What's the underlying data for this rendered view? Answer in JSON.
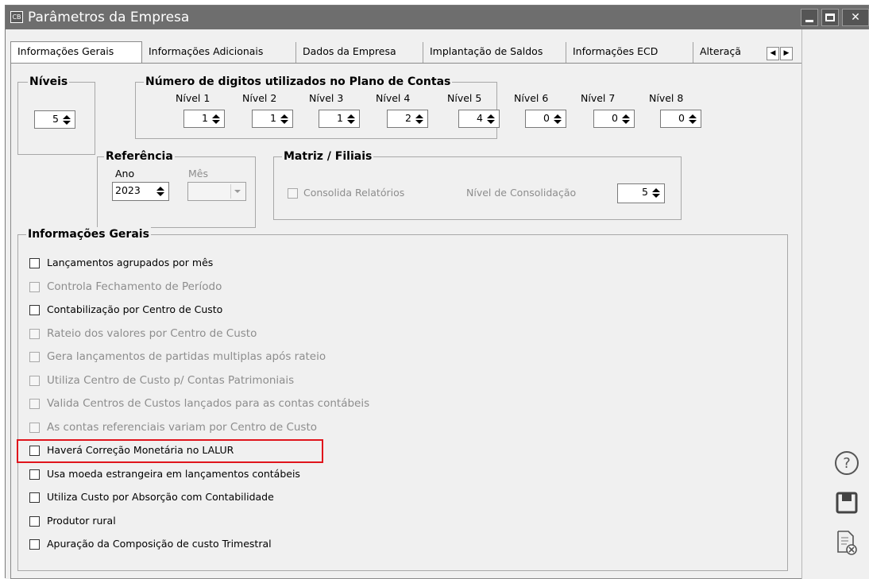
{
  "window": {
    "title": "Parâmetros da Empresa",
    "app_icon_text": "CB",
    "buttons": [
      "minimize",
      "maximize",
      "close"
    ]
  },
  "tabs": [
    {
      "label": "Informações Gerais",
      "active": true
    },
    {
      "label": "Informações Adicionais"
    },
    {
      "label": "Dados da Empresa"
    },
    {
      "label": "Implantação de Saldos"
    },
    {
      "label": "Informações ECD"
    },
    {
      "label": "Alteraçã"
    }
  ],
  "niveis": {
    "legend": "Níveis",
    "value": "5"
  },
  "digitos": {
    "legend": "Número de digitos utilizados no Plano de Contas",
    "levels": [
      {
        "label": "Nível 1",
        "value": "1"
      },
      {
        "label": "Nível 2",
        "value": "1"
      },
      {
        "label": "Nível 3",
        "value": "1"
      },
      {
        "label": "Nível 4",
        "value": "2"
      },
      {
        "label": "Nível 5",
        "value": "4"
      },
      {
        "label": "Nível 6",
        "value": "0"
      },
      {
        "label": "Nível 7",
        "value": "0"
      },
      {
        "label": "Nível 8",
        "value": "0"
      }
    ]
  },
  "referencia": {
    "legend": "Referência",
    "ano_label": "Ano",
    "ano_value": "2023",
    "mes_label": "Mês",
    "mes_value": ""
  },
  "matriz": {
    "legend": "Matriz / Filiais",
    "consolida_label": "Consolida Relatórios",
    "nivel_label": "Nível de Consolidação",
    "nivel_value": "5"
  },
  "gerais": {
    "legend": "Informações Gerais",
    "options": [
      {
        "label": "Lançamentos agrupados por mês",
        "checked": false,
        "enabled": true
      },
      {
        "label": "Controla Fechamento de Período",
        "checked": false,
        "enabled": false
      },
      {
        "label": "Contabilização por Centro de Custo",
        "checked": false,
        "enabled": true
      },
      {
        "label": "Rateio dos valores por Centro de Custo",
        "checked": false,
        "enabled": false
      },
      {
        "label": "Gera lançamentos de partidas multiplas após rateio",
        "checked": false,
        "enabled": false
      },
      {
        "label": "Utiliza Centro de  Custo p/ Contas Patrimoniais",
        "checked": false,
        "enabled": false
      },
      {
        "label": "Valida Centros de Custos lançados para as contas contábeis",
        "checked": false,
        "enabled": false
      },
      {
        "label": "As contas referenciais variam por Centro de Custo",
        "checked": false,
        "enabled": false
      },
      {
        "label": "Haverá Correção Monetária  no LALUR",
        "checked": false,
        "enabled": true,
        "highlighted": true
      },
      {
        "label": "Usa moeda estrangeira em lançamentos contábeis",
        "checked": false,
        "enabled": true
      },
      {
        "label": "Utiliza Custo por Absorção com Contabilidade",
        "checked": false,
        "enabled": true
      },
      {
        "label": "Produtor rural",
        "checked": false,
        "enabled": true
      },
      {
        "label": "Apuração da Composição de custo Trimestral",
        "checked": false,
        "enabled": true
      }
    ]
  },
  "highlight_color": "#e0141c",
  "right_panel": {
    "icons": [
      "help-icon",
      "save-icon",
      "cancel-document-icon"
    ]
  }
}
